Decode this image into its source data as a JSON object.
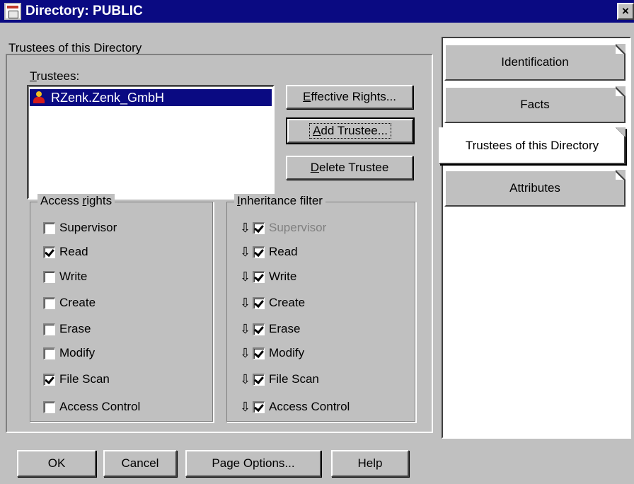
{
  "window": {
    "title": "Directory: PUBLIC",
    "close_glyph": "×"
  },
  "page_title": "Trustees of this Directory",
  "trustees": {
    "label_underlined": "T",
    "label_rest": "rustees:",
    "items": [
      {
        "name": "RZenk.Zenk_GmbH",
        "selected": true,
        "icon": "user-icon"
      }
    ]
  },
  "buttons": {
    "effective_rights": {
      "u": "E",
      "rest": "ffective Rights..."
    },
    "add_trustee": {
      "u": "A",
      "rest": "dd Trustee..."
    },
    "delete_trustee": {
      "u": "D",
      "rest": "elete Trustee"
    }
  },
  "access_rights": {
    "title_pre": "Access ",
    "title_u": "r",
    "title_post": "ights",
    "items": [
      {
        "label": "Supervisor",
        "checked": false
      },
      {
        "label": "Read",
        "checked": true
      },
      {
        "label": "Write",
        "checked": false
      },
      {
        "label": "Create",
        "checked": false
      },
      {
        "label": "Erase",
        "checked": false
      },
      {
        "label": "Modify",
        "checked": false
      },
      {
        "label": "File Scan",
        "checked": true
      },
      {
        "label": "Access Control",
        "checked": false
      }
    ]
  },
  "inheritance_filter": {
    "title_u": "I",
    "title_rest": "nheritance filter",
    "arrow_glyph": "⇩",
    "items": [
      {
        "label": "Supervisor",
        "checked": true,
        "disabled": true
      },
      {
        "label": "Read",
        "checked": true,
        "disabled": false
      },
      {
        "label": "Write",
        "checked": true,
        "disabled": false
      },
      {
        "label": "Create",
        "checked": true,
        "disabled": false
      },
      {
        "label": "Erase",
        "checked": true,
        "disabled": false
      },
      {
        "label": "Modify",
        "checked": true,
        "disabled": false
      },
      {
        "label": "File Scan",
        "checked": true,
        "disabled": false
      },
      {
        "label": "Access Control",
        "checked": true,
        "disabled": false
      }
    ]
  },
  "tabs": [
    {
      "label": "Identification",
      "active": false
    },
    {
      "label": "Facts",
      "active": false
    },
    {
      "label": "Trustees of this Directory",
      "active": true
    },
    {
      "label": "Attributes",
      "active": false
    }
  ],
  "footer": {
    "ok": "OK",
    "cancel": "Cancel",
    "page_options": "Page Options...",
    "help": "Help"
  }
}
